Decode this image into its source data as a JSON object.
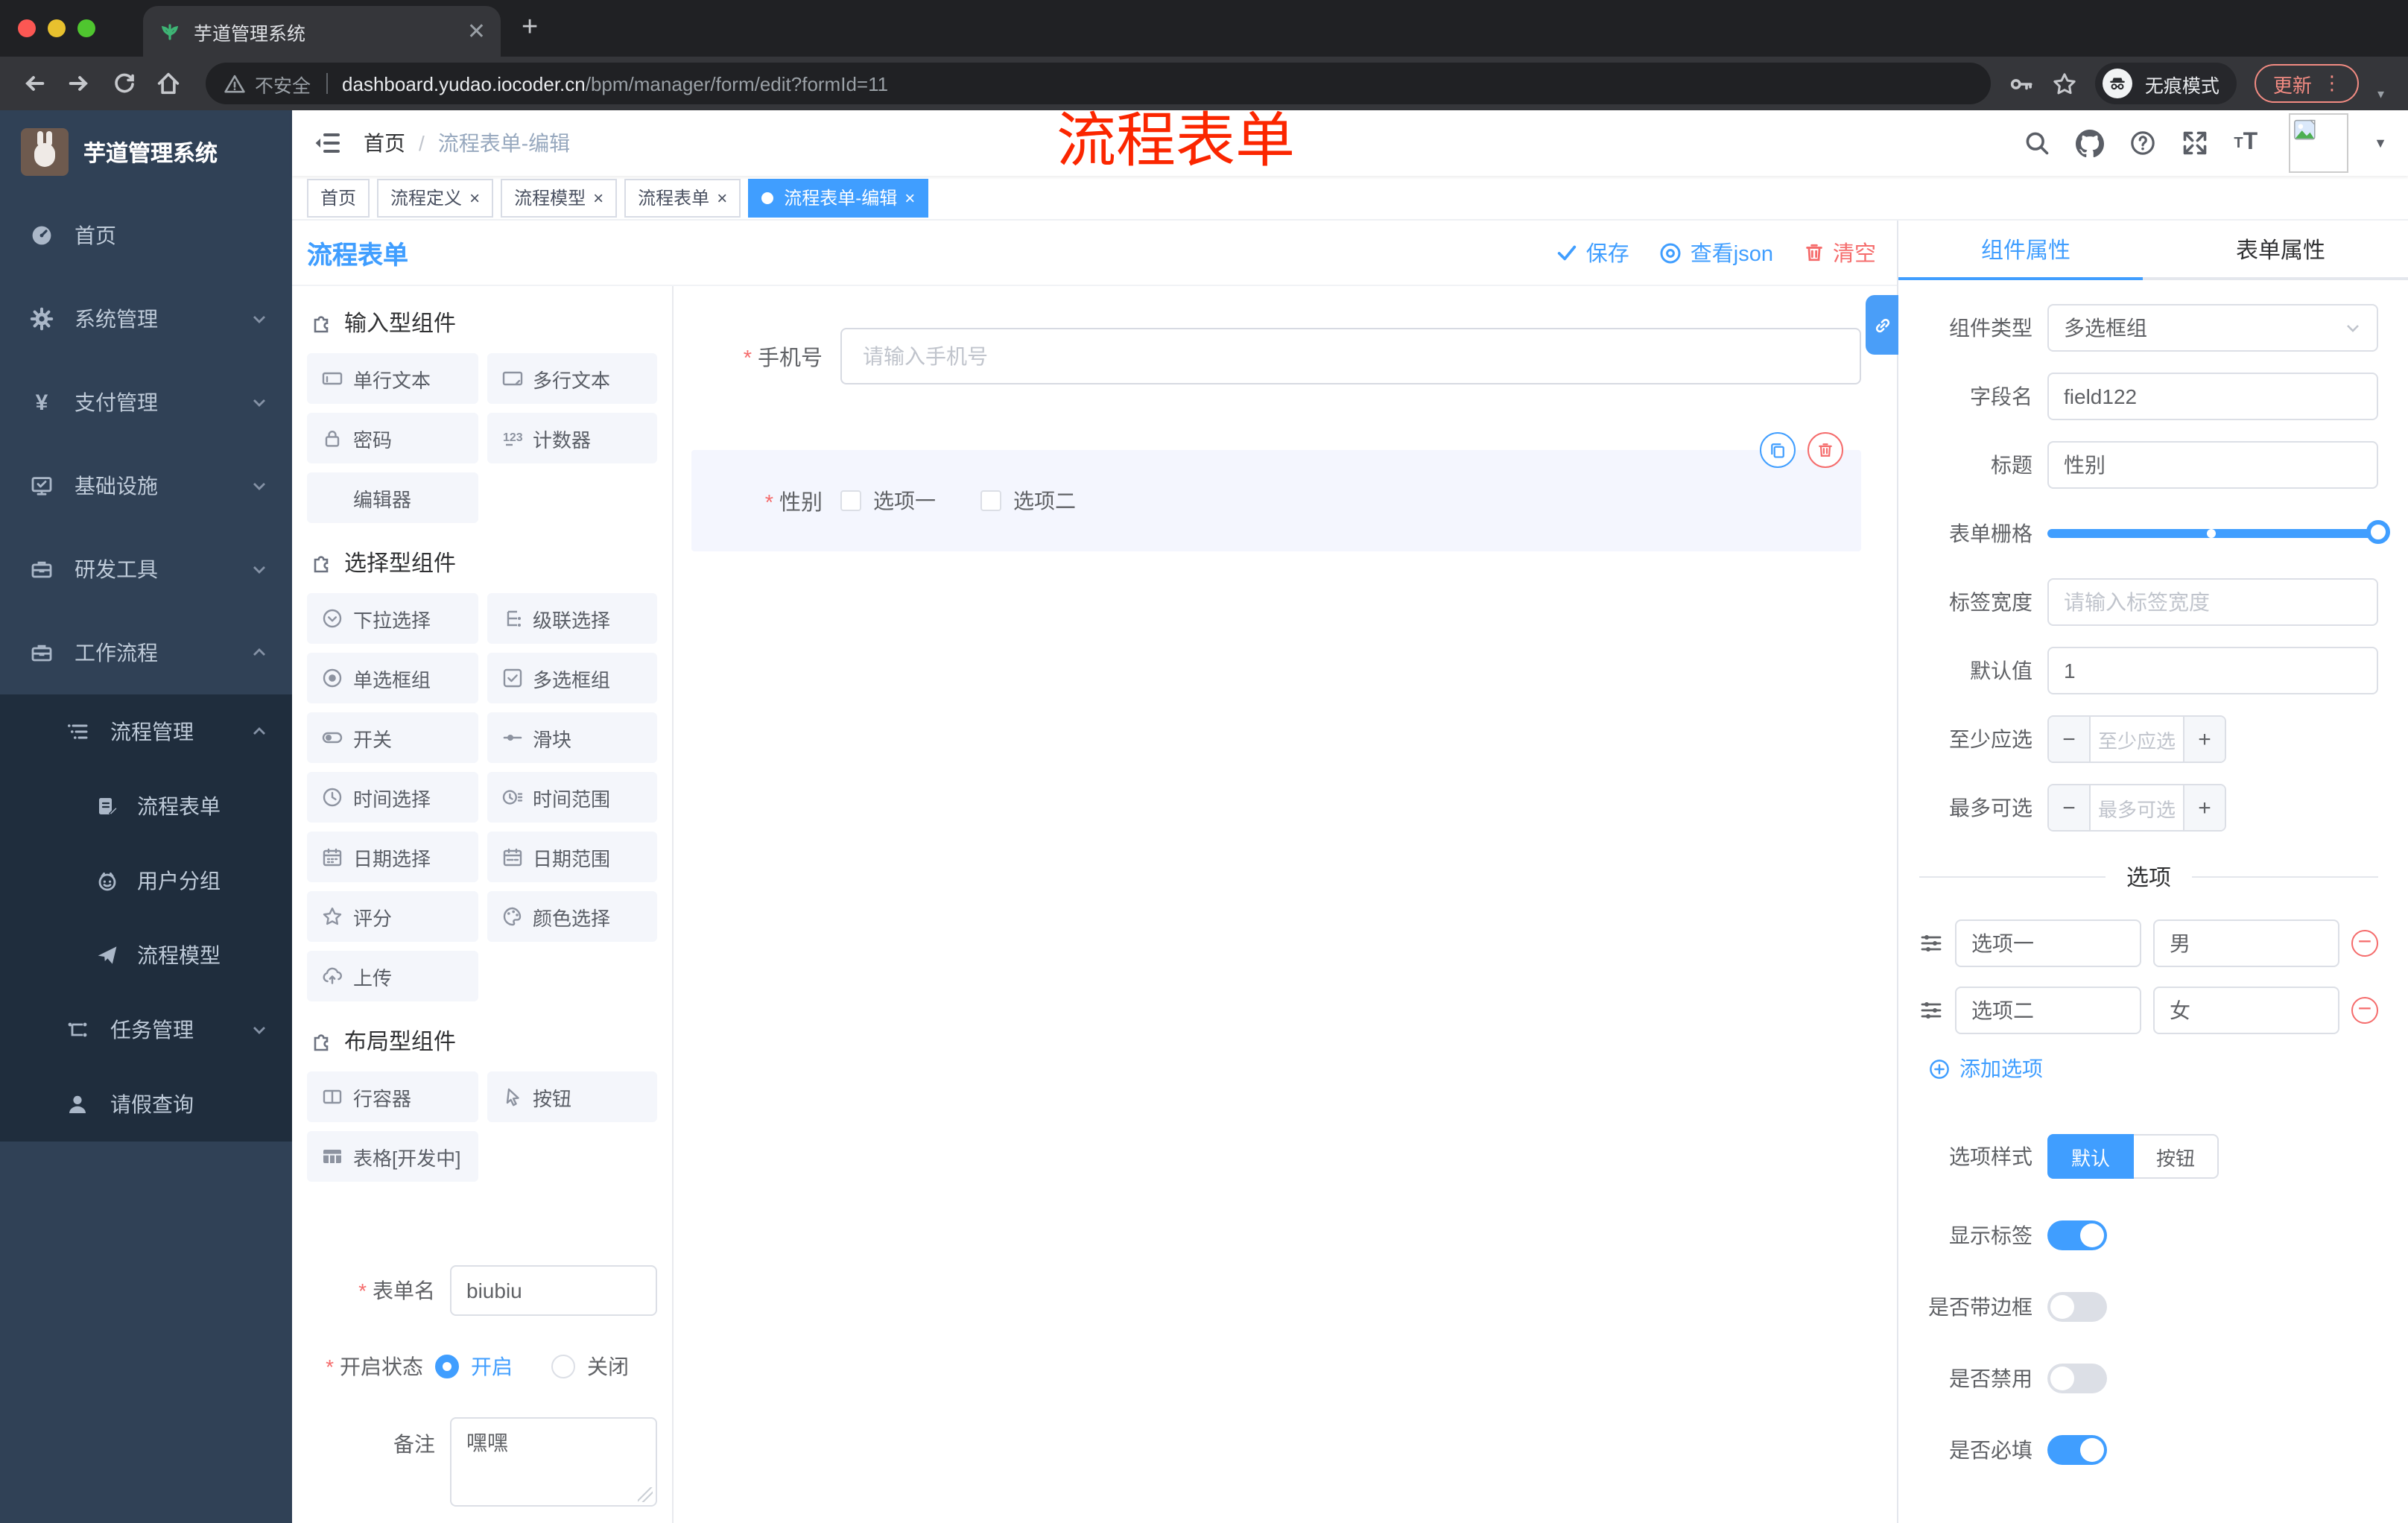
{
  "chrome": {
    "tab_title": "芋道管理系统",
    "new_tab": "+",
    "security": "不安全",
    "url_host": "dashboard.yudao.iocoder.cn",
    "url_path": "/bpm/manager/form/edit?formId=11",
    "incognito": "无痕模式",
    "update": "更新"
  },
  "nav": {
    "breadcrumb_home": "首页",
    "breadcrumb_sep": "/",
    "breadcrumb_current": "流程表单-编辑",
    "annotation": "流程表单"
  },
  "tags": {
    "items": [
      {
        "label": "首页"
      },
      {
        "label": "流程定义"
      },
      {
        "label": "流程模型"
      },
      {
        "label": "流程表单"
      },
      {
        "label": "流程表单-编辑"
      }
    ]
  },
  "sidebar": {
    "title": "芋道管理系统",
    "home": "首页",
    "system": "系统管理",
    "pay": "支付管理",
    "infra": "基础设施",
    "dev": "研发工具",
    "workflow": "工作流程",
    "process_mgmt": "流程管理",
    "process_form": "流程表单",
    "user_group": "用户分组",
    "process_model": "流程模型",
    "task_mgmt": "任务管理",
    "leave_query": "请假查询"
  },
  "toolbar": {
    "title": "流程表单",
    "save": "保存",
    "view_json": "查看json",
    "clear": "清空"
  },
  "palette": {
    "input_title": "输入型组件",
    "select_title": "选择型组件",
    "layout_title": "布局型组件",
    "input_items": [
      "单行文本",
      "多行文本",
      "密码",
      "计数器",
      "编辑器"
    ],
    "select_items": [
      "下拉选择",
      "级联选择",
      "单选框组",
      "多选框组",
      "开关",
      "滑块",
      "时间选择",
      "时间范围",
      "日期选择",
      "日期范围",
      "评分",
      "颜色选择",
      "上传"
    ],
    "layout_items": [
      "行容器",
      "按钮",
      "表格[开发中]"
    ]
  },
  "form_meta": {
    "name_label": "表单名",
    "name_value": "biubiu",
    "status_label": "开启状态",
    "status_on": "开启",
    "status_off": "关闭",
    "remark_label": "备注",
    "remark_value": "嘿嘿"
  },
  "canvas": {
    "phone_label": "手机号",
    "phone_placeholder": "请输入手机号",
    "gender_label": "性别",
    "option1": "选项一",
    "option2": "选项二"
  },
  "panel": {
    "tab_component": "组件属性",
    "tab_form": "表单属性",
    "type_label": "组件类型",
    "type_value": "多选框组",
    "field_label": "字段名",
    "field_value": "field122",
    "title_label": "标题",
    "title_value": "性别",
    "grid_label": "表单栅格",
    "labelw_label": "标签宽度",
    "labelw_placeholder": "请输入标签宽度",
    "default_label": "默认值",
    "default_value": "1",
    "min_label": "至少应选",
    "min_placeholder": "至少应选",
    "max_label": "最多可选",
    "max_placeholder": "最多可选",
    "options_title": "选项",
    "opt1_label": "选项一",
    "opt1_value": "男",
    "opt2_label": "选项二",
    "opt2_value": "女",
    "add_option": "添加选项",
    "style_label": "选项样式",
    "style_default": "默认",
    "style_button": "按钮",
    "show_label": "显示标签",
    "border_label": "是否带边框",
    "disable_label": "是否禁用",
    "required_label": "是否必填"
  },
  "colors": {
    "accent": "#409eff",
    "danger": "#f56c6c",
    "annotation": "#fb2600"
  }
}
